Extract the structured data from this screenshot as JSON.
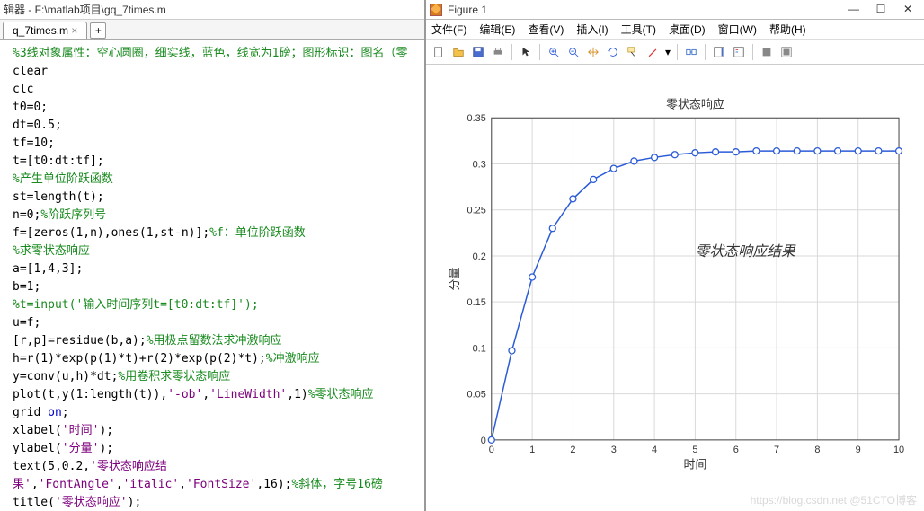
{
  "editor": {
    "title": "辑器 - F:\\matlab项目\\gq_7times.m",
    "tab": "q_7times.m",
    "tab_add": "+",
    "lines": [
      {
        "t": "cmt",
        "v": "%3线对象属性：空心圆圈，细实线，蓝色，线宽为1磅；图形标识：图名（零"
      },
      {
        "t": "plain",
        "v": "clear"
      },
      {
        "t": "plain",
        "v": "clc"
      },
      {
        "t": "plain",
        "v": "t0=0;"
      },
      {
        "t": "plain",
        "v": "dt=0.5;"
      },
      {
        "t": "plain",
        "v": "tf=10;"
      },
      {
        "t": "plain",
        "v": "t=[t0:dt:tf];"
      },
      {
        "t": "cmt",
        "v": "%产生单位阶跃函数"
      },
      {
        "t": "plain",
        "v": "st=length(t);"
      },
      {
        "t": "mix",
        "pre": "n=0;",
        "post": "%阶跃序列号"
      },
      {
        "t": "mix",
        "pre": "f=[zeros(1,n),ones(1,st-n)];",
        "post": "%f：单位阶跃函数"
      },
      {
        "t": "cmt",
        "v": "%求零状态响应"
      },
      {
        "t": "plain",
        "v": "a=[1,4,3];"
      },
      {
        "t": "plain",
        "v": "b=1;"
      },
      {
        "t": "cmt",
        "v": "%t=input('输入时间序列t=[t0:dt:tf]');"
      },
      {
        "t": "plain",
        "v": "u=f;"
      },
      {
        "t": "mix",
        "pre": "[r,p]=residue(b,a);",
        "post": "%用极点留数法求冲激响应"
      },
      {
        "t": "mix",
        "pre": "h=r(1)*exp(p(1)*t)+r(2)*exp(p(2)*t);",
        "post": "%冲激响应"
      },
      {
        "t": "mix",
        "pre": "y=conv(u,h)*dt;",
        "post": "%用卷积求零状态响应"
      },
      {
        "t": "plot",
        "pre": "plot(t,y(1:length(t)),",
        "s1": "'-ob'",
        "mid": ",",
        "s2": "'LineWidth'",
        "post": ",1)%零状态响应"
      },
      {
        "t": "grid",
        "pre": "grid ",
        "kw": "on",
        "post": ";"
      },
      {
        "t": "lbl",
        "pre": "xlabel(",
        "s": "'时间'",
        "post": ");"
      },
      {
        "t": "lbl",
        "pre": "ylabel(",
        "s": "'分量'",
        "post": ");"
      },
      {
        "t": "txt",
        "pre": "text(5,0.2,",
        "s1": "'零状态响应结果'",
        "m1": ",",
        "s2": "'FontAngle'",
        "m2": ",",
        "s3": "'italic'",
        "m3": ",",
        "s4": "'FontSize'",
        "post": ",16);%斜体，字号16磅"
      },
      {
        "t": "lbl",
        "pre": "title(",
        "s": "'零状态响应'",
        "post": ");"
      }
    ]
  },
  "figure": {
    "title": "Figure 1",
    "menu": [
      "文件(F)",
      "编辑(E)",
      "查看(V)",
      "插入(I)",
      "工具(T)",
      "桌面(D)",
      "窗口(W)",
      "帮助(H)"
    ],
    "win_min": "—",
    "win_max": "☐",
    "win_close": "✕"
  },
  "chart_data": {
    "type": "line",
    "title": "零状态响应",
    "xlabel": "时间",
    "ylabel": "分量",
    "xlim": [
      0,
      10
    ],
    "ylim": [
      0,
      0.35
    ],
    "xticks": [
      0,
      1,
      2,
      3,
      4,
      5,
      6,
      7,
      8,
      9,
      10
    ],
    "yticks": [
      0,
      0.05,
      0.1,
      0.15,
      0.2,
      0.25,
      0.3,
      0.35
    ],
    "annotation": {
      "x": 5,
      "y": 0.2,
      "text": "零状态响应结果"
    },
    "series": [
      {
        "name": "y",
        "x": [
          0,
          0.5,
          1,
          1.5,
          2,
          2.5,
          3,
          3.5,
          4,
          4.5,
          5,
          5.5,
          6,
          6.5,
          7,
          7.5,
          8,
          8.5,
          9,
          9.5,
          10
        ],
        "y": [
          0,
          0.097,
          0.177,
          0.23,
          0.262,
          0.283,
          0.295,
          0.303,
          0.307,
          0.31,
          0.312,
          0.313,
          0.313,
          0.314,
          0.314,
          0.314,
          0.314,
          0.314,
          0.314,
          0.314,
          0.314
        ]
      }
    ]
  },
  "watermark": "https://blog.csdn.net  @51CTO博客"
}
